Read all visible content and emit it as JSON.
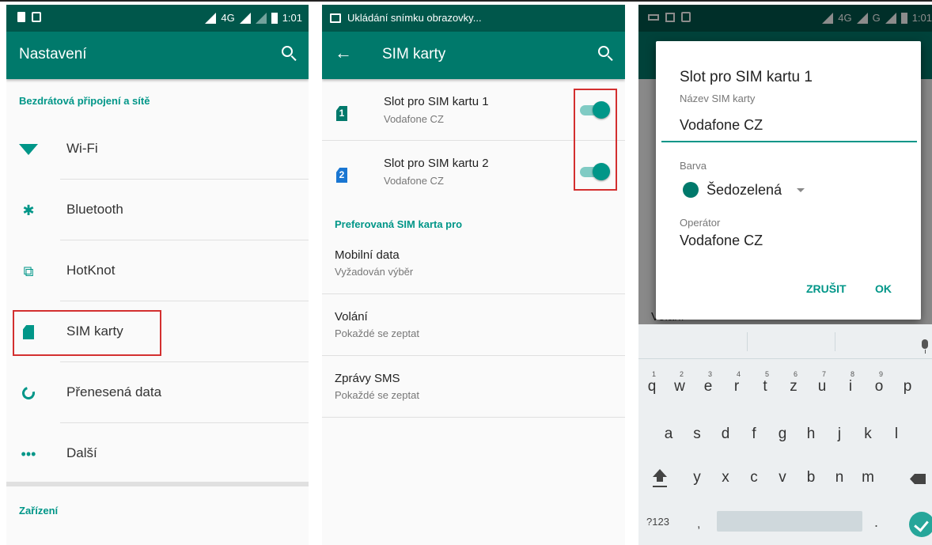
{
  "colors": {
    "teal": "#009688",
    "status_bar": "#00574b",
    "app_bar": "#00796b",
    "highlight_red": "#d32f2f",
    "dialog_color": "#00796b"
  },
  "panel1": {
    "status": {
      "icons": [
        "sd-icon",
        "lock-icon"
      ],
      "network": "4G",
      "time": "1:01"
    },
    "title": "Nastavení",
    "section1": "Bezdrátová připojení a sítě",
    "items": [
      {
        "label": "Wi-Fi",
        "icon": "wifi-icon"
      },
      {
        "label": "Bluetooth",
        "icon": "bluetooth-icon"
      },
      {
        "label": "HotKnot",
        "icon": "hotknot-icon"
      },
      {
        "label": "SIM karty",
        "icon": "sim-card-icon"
      },
      {
        "label": "Přenesená data",
        "icon": "data-usage-icon"
      },
      {
        "label": "Další",
        "icon": "more-icon"
      }
    ],
    "section2": "Zařízení"
  },
  "panel2": {
    "status": {
      "notification": "Ukládání snímku obrazovky..."
    },
    "title": "SIM karty",
    "sims": [
      {
        "title": "Slot pro SIM kartu 1",
        "subtitle": "Vodafone CZ",
        "badge": "1",
        "badge_color": "#00796b",
        "enabled": true
      },
      {
        "title": "Slot pro SIM kartu 2",
        "subtitle": "Vodafone CZ",
        "badge": "2",
        "badge_color": "#1976d2",
        "enabled": true
      }
    ],
    "section": "Preferovaná SIM karta pro",
    "prefs": [
      {
        "title": "Mobilní data",
        "subtitle": "Vyžadován výběr"
      },
      {
        "title": "Volání",
        "subtitle": "Pokaždé se zeptat"
      },
      {
        "title": "Zprávy SMS",
        "subtitle": "Pokaždé se zeptat"
      }
    ]
  },
  "panel3": {
    "status": {
      "network": "4G",
      "network2": "G",
      "time": "1:01"
    },
    "bg_label": "Volání",
    "dialog": {
      "title": "Slot pro SIM kartu 1",
      "name_label": "Název SIM karty",
      "name_value": "Vodafone CZ",
      "color_label": "Barva",
      "color_value": "Šedozelená",
      "operator_label": "Operátor",
      "operator_value": "Vodafone CZ",
      "cancel": "ZRUŠIT",
      "ok": "OK"
    },
    "keyboard": {
      "row1": [
        "q",
        "w",
        "e",
        "r",
        "t",
        "z",
        "u",
        "i",
        "o",
        "p"
      ],
      "row1_nums": [
        "1",
        "2",
        "3",
        "4",
        "5",
        "6",
        "7",
        "8",
        "9",
        "0"
      ],
      "row2": [
        "a",
        "s",
        "d",
        "f",
        "g",
        "h",
        "j",
        "k",
        "l"
      ],
      "row3": [
        "y",
        "x",
        "c",
        "v",
        "b",
        "n",
        "m"
      ],
      "symbols": "?123",
      "comma": ",",
      "period": "."
    }
  }
}
